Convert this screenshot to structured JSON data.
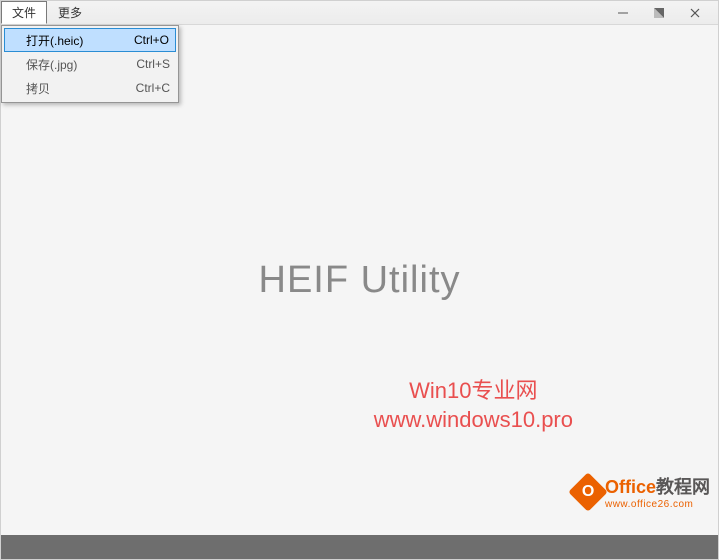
{
  "menubar": {
    "items": [
      {
        "label": "文件",
        "open": true
      },
      {
        "label": "更多",
        "open": false
      }
    ]
  },
  "dropdown": {
    "items": [
      {
        "label": "打开(.heic)",
        "shortcut": "Ctrl+O",
        "highlight": true
      },
      {
        "label": "保存(.jpg)",
        "shortcut": "Ctrl+S",
        "highlight": false
      },
      {
        "label": "拷贝",
        "shortcut": "Ctrl+C",
        "highlight": false
      }
    ]
  },
  "main": {
    "title": "HEIF Utility"
  },
  "watermark": {
    "line1": "Win10专业网",
    "line2": "www.windows10.pro"
  },
  "brand": {
    "logo_letter": "O",
    "name_colored": "Office",
    "name_suffix": "教程网",
    "url": "www.office26.com"
  }
}
